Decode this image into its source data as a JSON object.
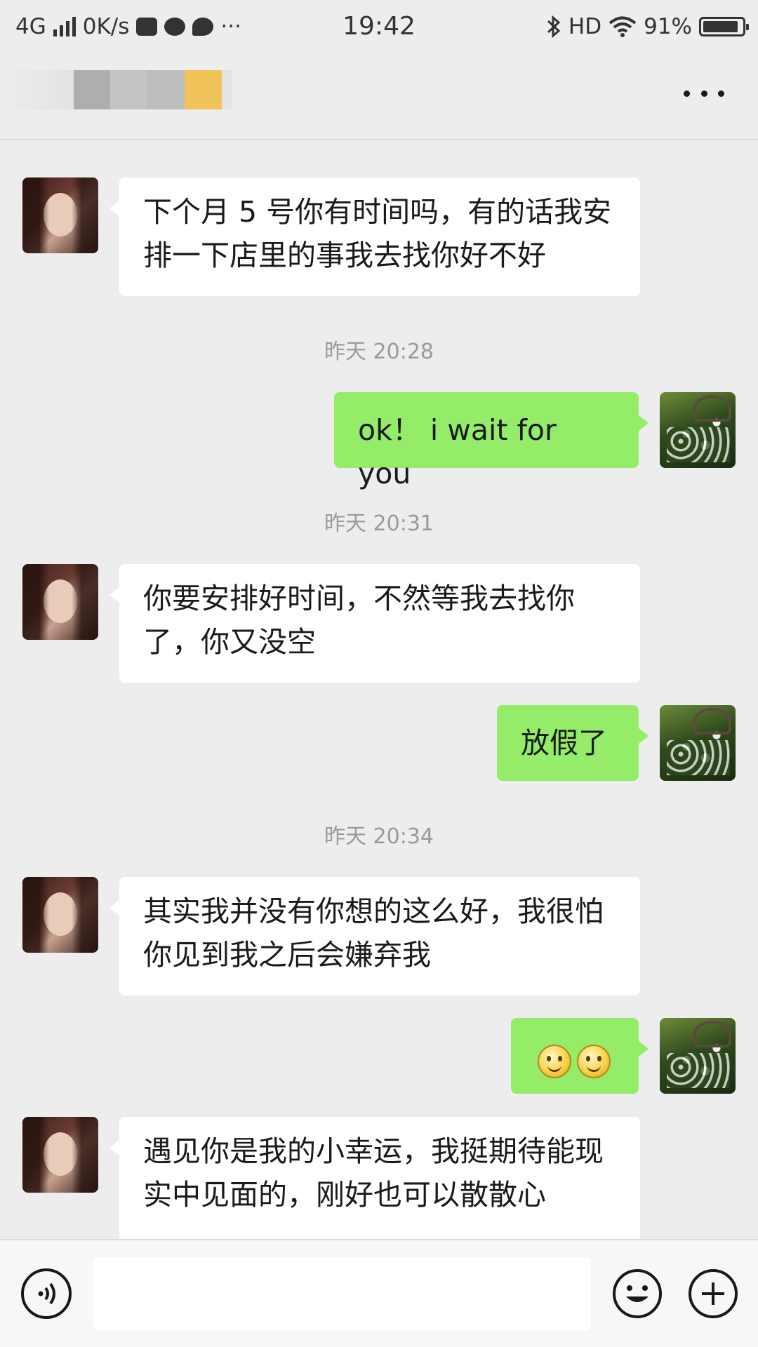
{
  "status_bar": {
    "network": "4G",
    "speed": "0K/s",
    "overflow": "···",
    "time": "19:42",
    "hd": "HD",
    "battery": "91%",
    "battery_level": 0.91,
    "icons": [
      "signal-icon",
      "notification-icon",
      "chat-notification-icon",
      "message-notification-icon",
      "bluetooth-icon",
      "wifi-icon",
      "battery-icon"
    ]
  },
  "header": {
    "more_icon": "more-icon"
  },
  "messages": [
    {
      "side": "left",
      "text": "下个月 5 号你有时间吗，有的话我安排一下店里的事我去找你好不好"
    },
    {
      "timestamp": "昨天 20:28"
    },
    {
      "side": "right",
      "text": "ok！ i wait for you"
    },
    {
      "timestamp": "昨天 20:31"
    },
    {
      "side": "left",
      "text": "你要安排好时间，不然等我去找你了，你又没空"
    },
    {
      "side": "right",
      "text": "放假了"
    },
    {
      "timestamp": "昨天 20:34"
    },
    {
      "side": "left",
      "text": "其实我并没有你想的这么好，我很怕你见到我之后会嫌弃我"
    },
    {
      "side": "right",
      "emoji": [
        "smile-emoji",
        "smile-emoji"
      ]
    },
    {
      "side": "left",
      "text": "遇见你是我的小幸运，我挺期待能现实中见面的，刚好也可以散散心"
    }
  ],
  "chat": {
    "m1": "下个月 5 号你有时间吗，有的话我安排一下店里的事我去找你好不好",
    "t1": "昨天 20:28",
    "m2": "ok！ i wait for you",
    "t2": "昨天 20:31",
    "m3": "你要安排好时间，不然等我去找你了，你又没空",
    "m4": "放假了",
    "t3": "昨天 20:34",
    "m5": "其实我并没有你想的这么好，我很怕你见到我之后会嫌弃我",
    "m7": "遇见你是我的小幸运，我挺期待能现实中见面的，刚好也可以散散心"
  },
  "input_bar": {
    "placeholder": "",
    "icons": [
      "voice-icon",
      "emoji-icon",
      "plus-icon"
    ]
  },
  "colors": {
    "background": "#ededed",
    "bubble_mine": "#95ec69",
    "bubble_theirs": "#ffffff",
    "timestamp": "#9a9a9a"
  }
}
